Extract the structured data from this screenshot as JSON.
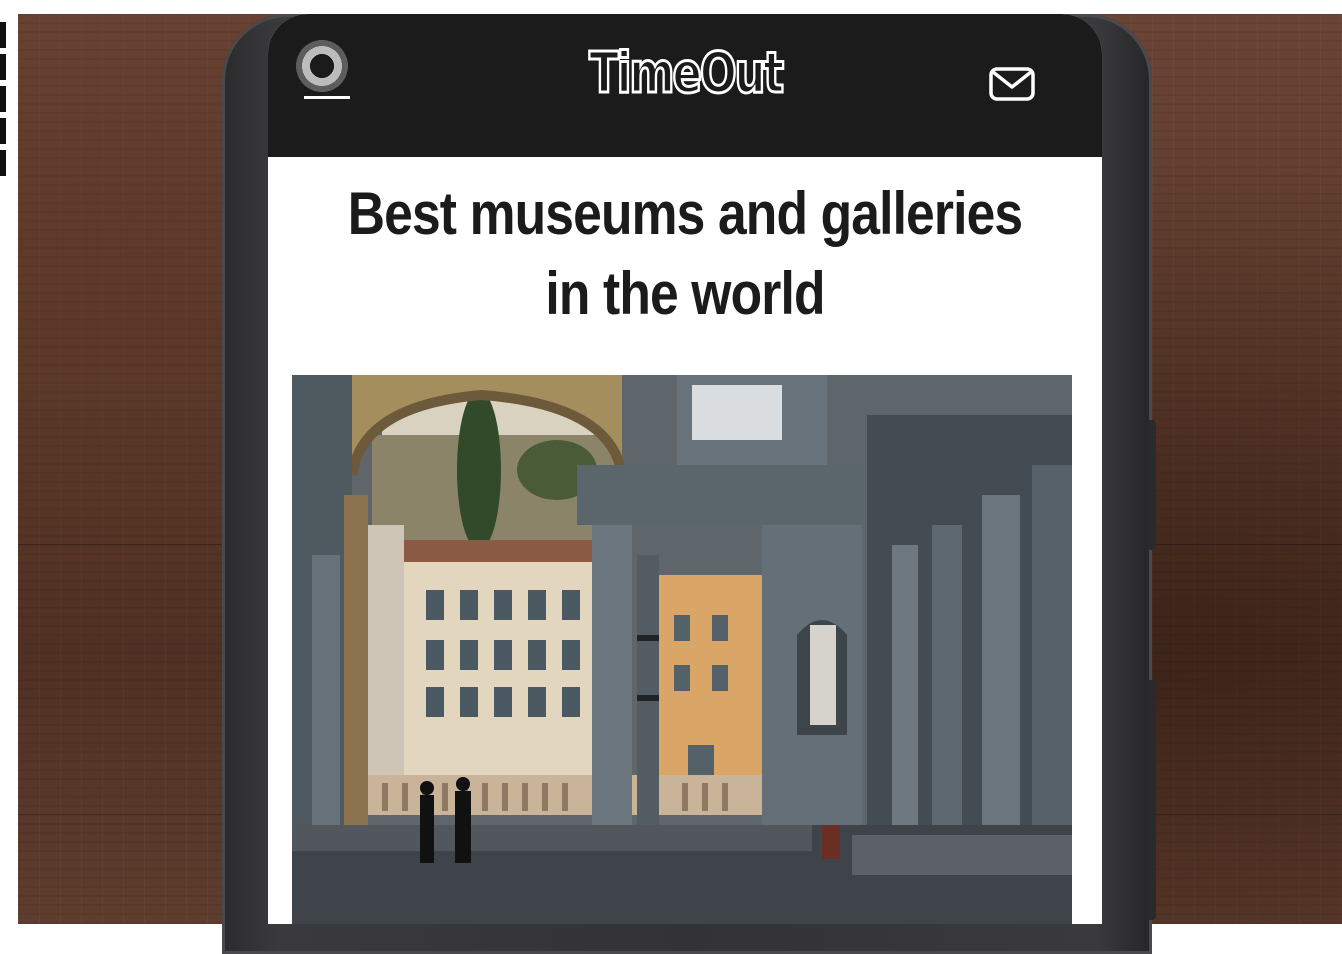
{
  "app": {
    "brand": "TimeOut",
    "menu_icon": "camera-menu-icon",
    "mail_icon": "mail-icon"
  },
  "article": {
    "title": "Best museums and galleries in the world",
    "hero_image_icon": "uffizi-gallery-courtyard-photo"
  },
  "colors": {
    "header_bg": "#1b1b1b",
    "screen_bg": "#ffffff",
    "title_text": "#1b1b1b",
    "wood": "#5b3a2c",
    "phone_frame": "#333335"
  }
}
